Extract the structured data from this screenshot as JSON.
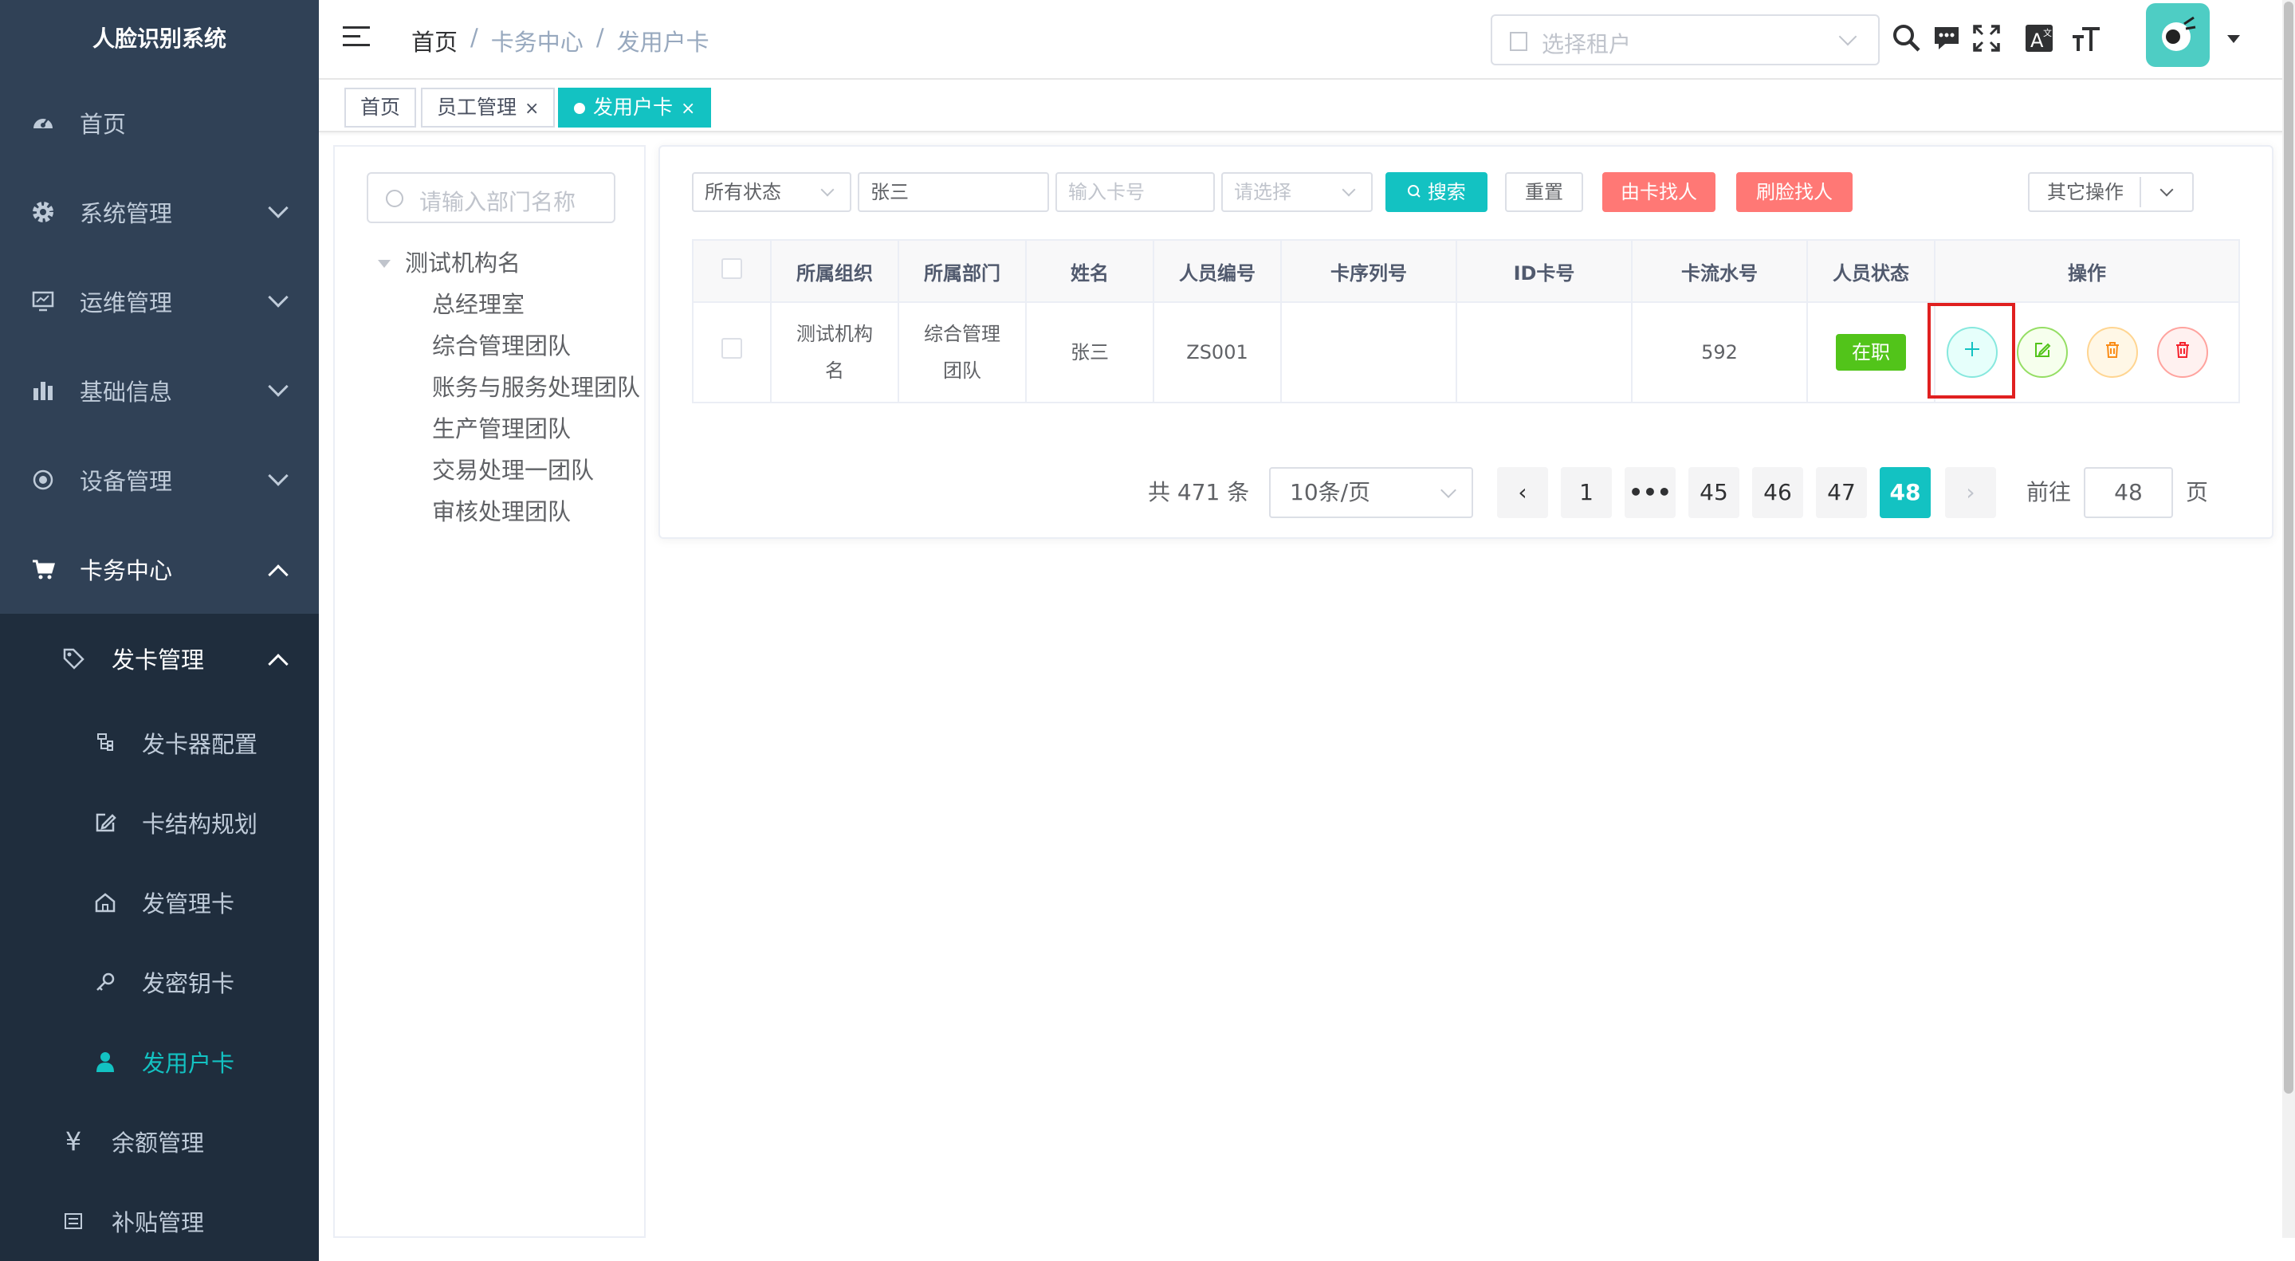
{
  "app": {
    "title": "人脸识别系统"
  },
  "sidebar": {
    "items": [
      {
        "label": "首页",
        "icon": "dashboard-icon"
      },
      {
        "label": "系统管理",
        "icon": "gear-icon"
      },
      {
        "label": "运维管理",
        "icon": "monitor-icon"
      },
      {
        "label": "基础信息",
        "icon": "bar-chart-icon"
      },
      {
        "label": "设备管理",
        "icon": "target-icon"
      },
      {
        "label": "卡务中心",
        "icon": "cart-icon"
      }
    ],
    "card_center": {
      "group": {
        "label": "发卡管理",
        "icon": "tag-icon"
      },
      "leaves": [
        {
          "label": "发卡器配置",
          "icon": "tree-icon"
        },
        {
          "label": "卡结构规划",
          "icon": "edit-icon"
        },
        {
          "label": "发管理卡",
          "icon": "home-icon"
        },
        {
          "label": "发密钥卡",
          "icon": "key-icon"
        },
        {
          "label": "发用户卡",
          "icon": "user-icon"
        }
      ],
      "others": [
        {
          "label": "余额管理",
          "icon": "yen-icon"
        },
        {
          "label": "补贴管理",
          "icon": "list-icon"
        }
      ]
    }
  },
  "header": {
    "breadcrumb": [
      "首页",
      "卡务中心",
      "发用户卡"
    ],
    "separator": "/",
    "tenant_placeholder": "选择租户"
  },
  "tags": [
    {
      "label": "首页"
    },
    {
      "label": "员工管理",
      "close": "×"
    },
    {
      "label": "发用户卡",
      "close": "×"
    }
  ],
  "left_panel": {
    "search_placeholder": "请输入部门名称",
    "tree": {
      "root": "测试机构名",
      "children": [
        "总经理室",
        "综合管理团队",
        "账务与服务处理团队",
        "生产管理团队",
        "交易处理一团队",
        "审核处理团队"
      ]
    }
  },
  "filters": {
    "status_value": "所有状态",
    "name_value": "张三",
    "card_placeholder": "输入卡号",
    "select_placeholder": "请选择",
    "search_button": "搜索",
    "reset_button": "重置",
    "find_by_card_button": "由卡找人",
    "find_by_face_button": "刷脸找人",
    "other_ops_button": "其它操作"
  },
  "table": {
    "headers": [
      "所属组织",
      "所属部门",
      "姓名",
      "人员编号",
      "卡序列号",
      "ID卡号",
      "卡流水号",
      "人员状态",
      "操作"
    ],
    "rows": [
      {
        "org": "测试机构名",
        "dept": "综合管理团队",
        "name": "张三",
        "emp_no": "ZS001",
        "card_serial": "",
        "id_card": "",
        "flow_no": "592",
        "status": "在职"
      }
    ]
  },
  "pagination": {
    "total_text": "共 471 条",
    "page_size": "10条/页",
    "pages": [
      "1",
      "•••",
      "45",
      "46",
      "47",
      "48"
    ],
    "current": "48",
    "goto_label": "前往",
    "goto_value": "48",
    "page_suffix": "页"
  },
  "colors": {
    "accent": "#13c2c2",
    "sidebar_bg": "#304156",
    "danger": "#ff7875",
    "success": "#52c41a",
    "highlight": "#e02020"
  }
}
